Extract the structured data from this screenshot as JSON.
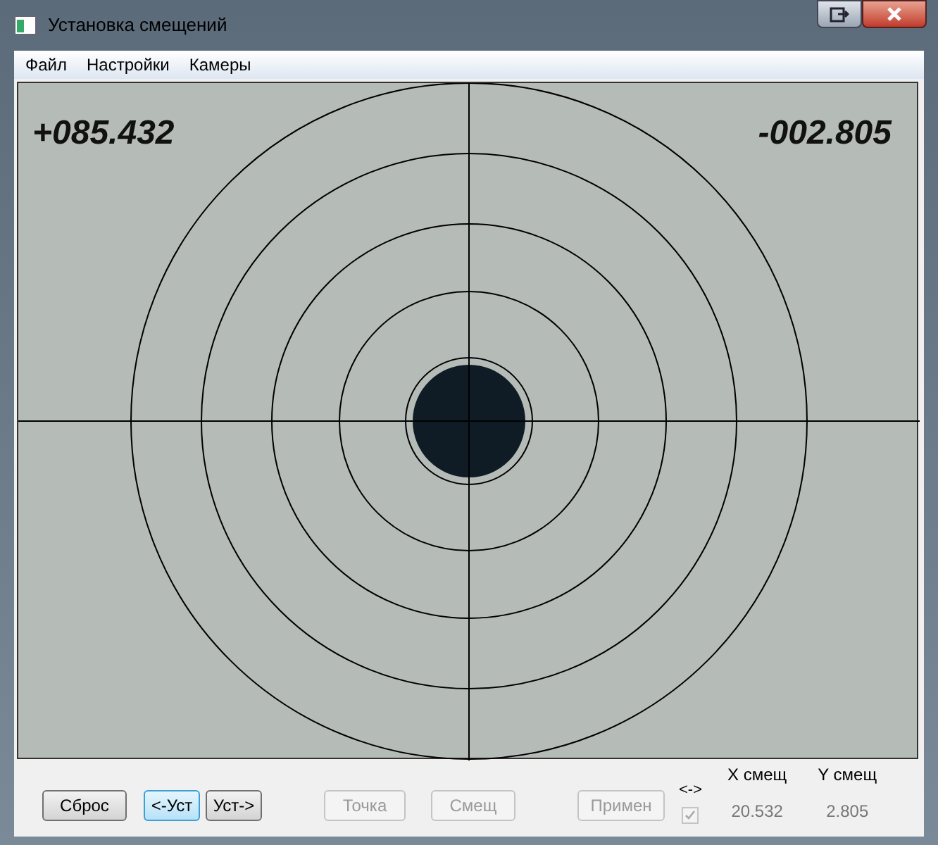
{
  "window": {
    "title": "Установка смещений"
  },
  "menu": [
    {
      "label": "Файл"
    },
    {
      "label": "Настройки"
    },
    {
      "label": "Камеры"
    }
  ],
  "view": {
    "x_readout": "+085.432",
    "y_readout": "-002.805"
  },
  "buttons": [
    {
      "label": "Сброс",
      "disabled": false,
      "focused": false
    },
    {
      "label": "<-Уст",
      "disabled": false,
      "focused": true
    },
    {
      "label": "Уст->",
      "disabled": false,
      "focused": false
    },
    {
      "label": "Точка",
      "disabled": true,
      "focused": false
    },
    {
      "label": "Смещ",
      "disabled": true,
      "focused": false
    },
    {
      "label": "Примен",
      "disabled": true,
      "focused": false
    }
  ],
  "swap": {
    "label": "<->",
    "checked": true,
    "disabled": true
  },
  "offsets": [
    {
      "heading": "X смещ",
      "value": "20.532"
    },
    {
      "heading": "Y смещ",
      "value": "2.805"
    }
  ]
}
